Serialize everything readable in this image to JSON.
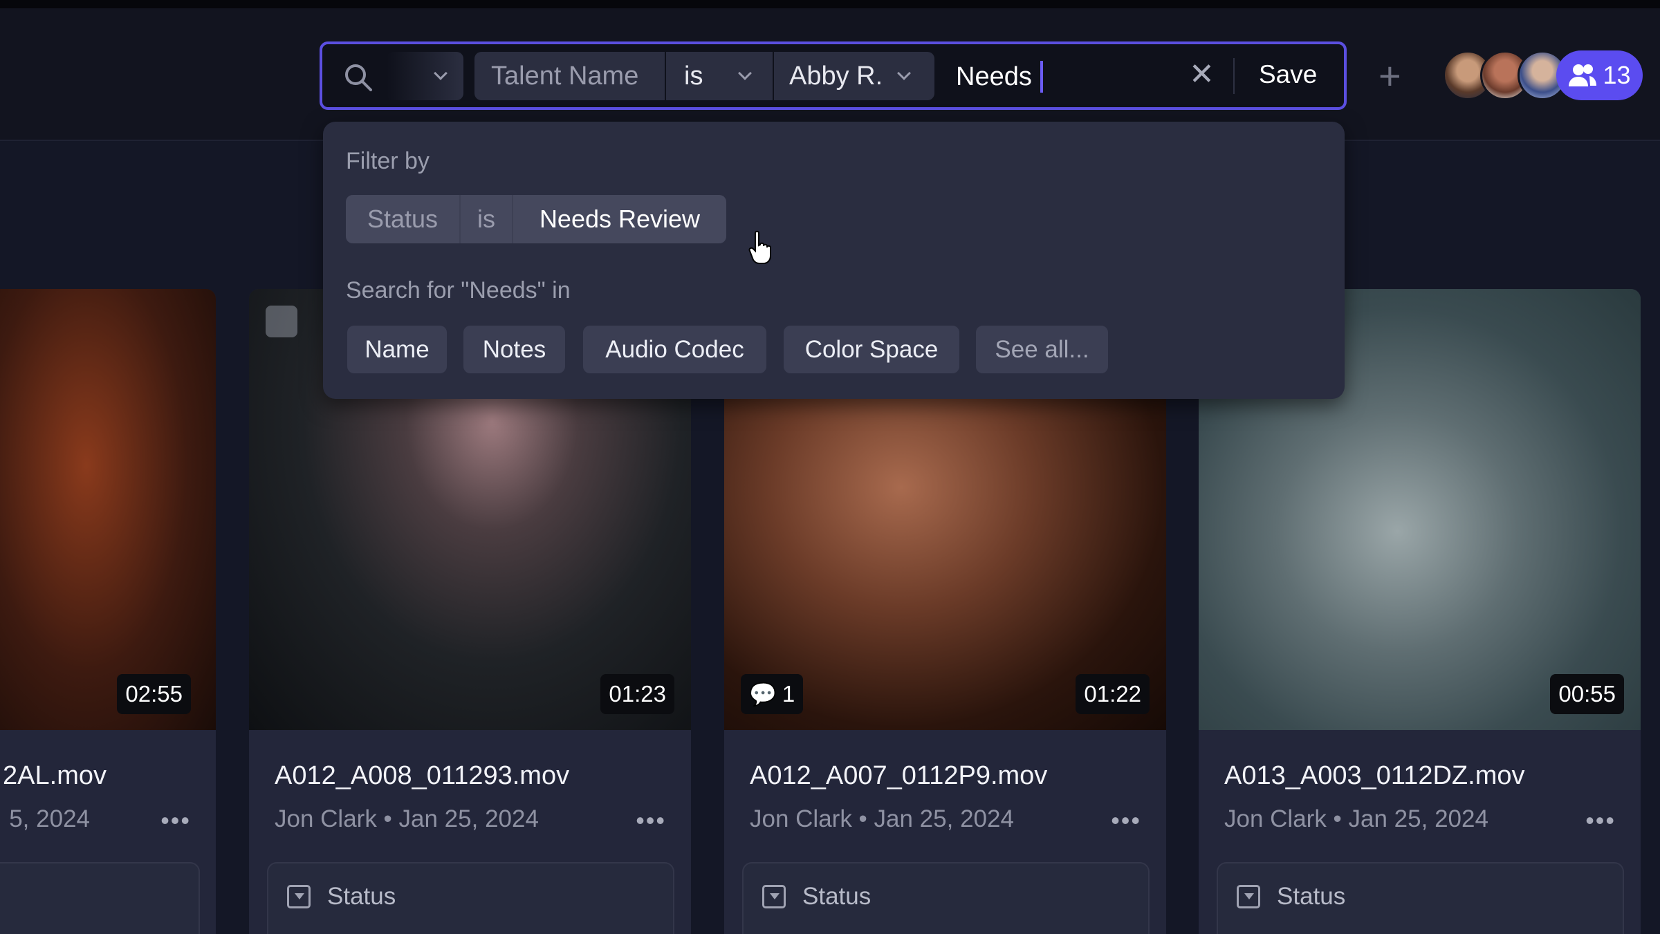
{
  "search": {
    "filter": {
      "field": "Talent Name",
      "operator": "is",
      "value": "Abby R."
    },
    "query": "Needs",
    "save_label": "Save"
  },
  "collaborators": {
    "count": "13"
  },
  "dropdown": {
    "filter_by_label": "Filter by",
    "suggestion": {
      "field": "Status",
      "operator": "is",
      "value": "Needs Review"
    },
    "search_in_label": "Search for \"Needs\" in",
    "fields": [
      "Name",
      "Notes",
      "Audio Codec",
      "Color Space",
      "See all..."
    ]
  },
  "cards": [
    {
      "name": "2AL.mov",
      "meta": "5, 2024",
      "duration": "02:55",
      "status": ""
    },
    {
      "name": "A012_A008_011293.mov",
      "meta": "Jon Clark • Jan 25, 2024",
      "duration": "01:23",
      "status": "Status"
    },
    {
      "name": "A012_A007_0112P9.mov",
      "meta": "Jon Clark • Jan 25, 2024",
      "duration": "01:22",
      "comments": "1",
      "status": "Status"
    },
    {
      "name": "A013_A003_0112DZ.mov",
      "meta": "Jon Clark • Jan 25, 2024",
      "duration": "00:55",
      "status": "Status"
    }
  ],
  "colors": {
    "accent": "#5b4fe0",
    "badge": "#5b4cf0",
    "background": "#141726",
    "card": "#23263a",
    "dropdown": "#2a2d40"
  }
}
